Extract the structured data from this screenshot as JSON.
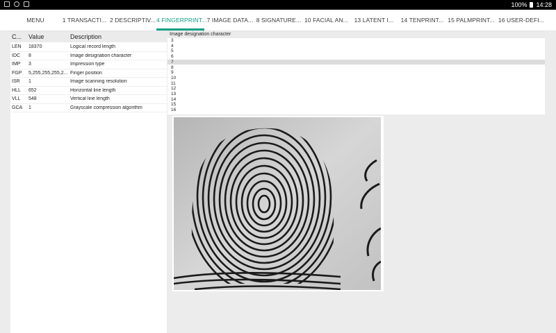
{
  "status_bar": {
    "battery": "100%",
    "time": "14:28"
  },
  "tabs": [
    {
      "label": "MENU"
    },
    {
      "label": "1 TRANSACTI..."
    },
    {
      "label": "2 DESCRIPTIV..."
    },
    {
      "label": "4 FINGERPRINT..."
    },
    {
      "label": "7 IMAGE DATA..."
    },
    {
      "label": "8 SIGNATURE..."
    },
    {
      "label": "10 FACIAL AN..."
    },
    {
      "label": "13 LATENT I..."
    },
    {
      "label": "14 TENPRINT..."
    },
    {
      "label": "15 PALMPRINT..."
    },
    {
      "label": "16 USER-DEFI..."
    }
  ],
  "active_tab": "4 FINGERPRINT...",
  "accent_color": "#0f9f86",
  "fields_table": {
    "headers": [
      "C...",
      "Value",
      "Description"
    ],
    "rows": [
      {
        "code": "LEN",
        "value": "18370",
        "description": "Logical record length"
      },
      {
        "code": "IDC",
        "value": "8",
        "description": "Image designation character"
      },
      {
        "code": "IMP",
        "value": "3",
        "description": "Impression type"
      },
      {
        "code": "FGP",
        "value": "5,255,255,255,2...",
        "description": "Finger position"
      },
      {
        "code": "ISR",
        "value": "1",
        "description": "Image scanning resolution"
      },
      {
        "code": "HLL",
        "value": "652",
        "description": "Horizontal line length"
      },
      {
        "code": "VLL",
        "value": "548",
        "description": "Vertical line length"
      },
      {
        "code": "GCA",
        "value": "1",
        "description": "Grayscale compression algorithm"
      }
    ]
  },
  "detail": {
    "header": "Image designation character",
    "values": [
      "3",
      "4",
      "5",
      "6",
      "7",
      "8",
      "9",
      "10",
      "11",
      "12",
      "13",
      "14",
      "15",
      "16"
    ],
    "selected": "7"
  },
  "fingerprint_image": {
    "subject": "fingerprint-image"
  }
}
